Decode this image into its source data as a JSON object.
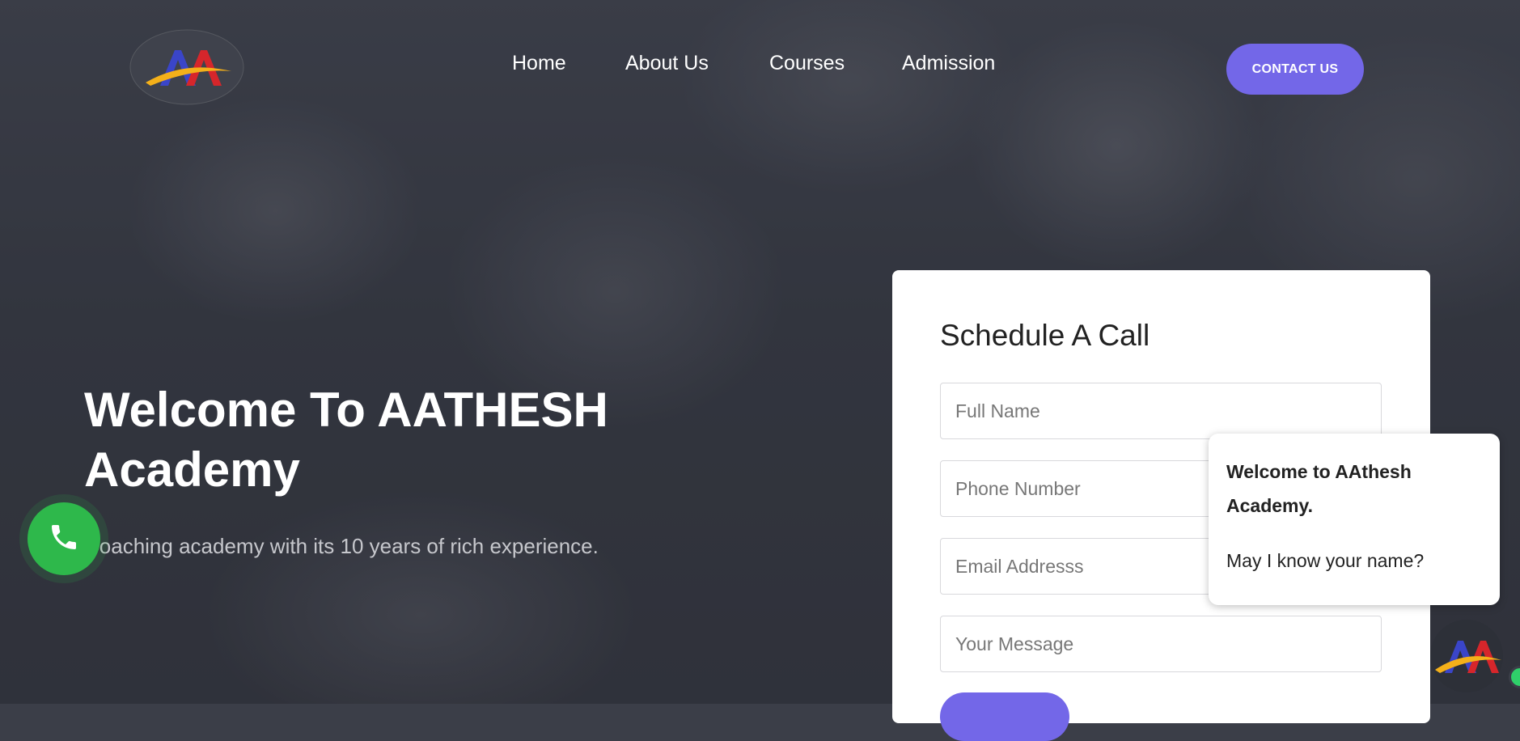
{
  "header": {
    "logo_text": "AA",
    "nav": [
      "Home",
      "About Us",
      "Courses",
      "Admission"
    ],
    "contact_label": "CONTACT US"
  },
  "hero": {
    "title": "Welcome To AATHESH Academy",
    "subtitle": "Coaching academy with its 10 years of rich experience."
  },
  "form": {
    "title": "Schedule A Call",
    "full_name_placeholder": "Full Name",
    "phone_placeholder": "Phone Number",
    "email_placeholder": "Email Addresss",
    "message_placeholder": "Your Message"
  },
  "chat": {
    "greeting": "Welcome to AAthesh Academy.",
    "question": "May I know your name?"
  },
  "colors": {
    "accent": "#7367e8",
    "phone_green": "#2eb84b",
    "online_green": "#2fd06a"
  },
  "icons": [
    "logo",
    "phone-icon",
    "chat-avatar-logo"
  ]
}
